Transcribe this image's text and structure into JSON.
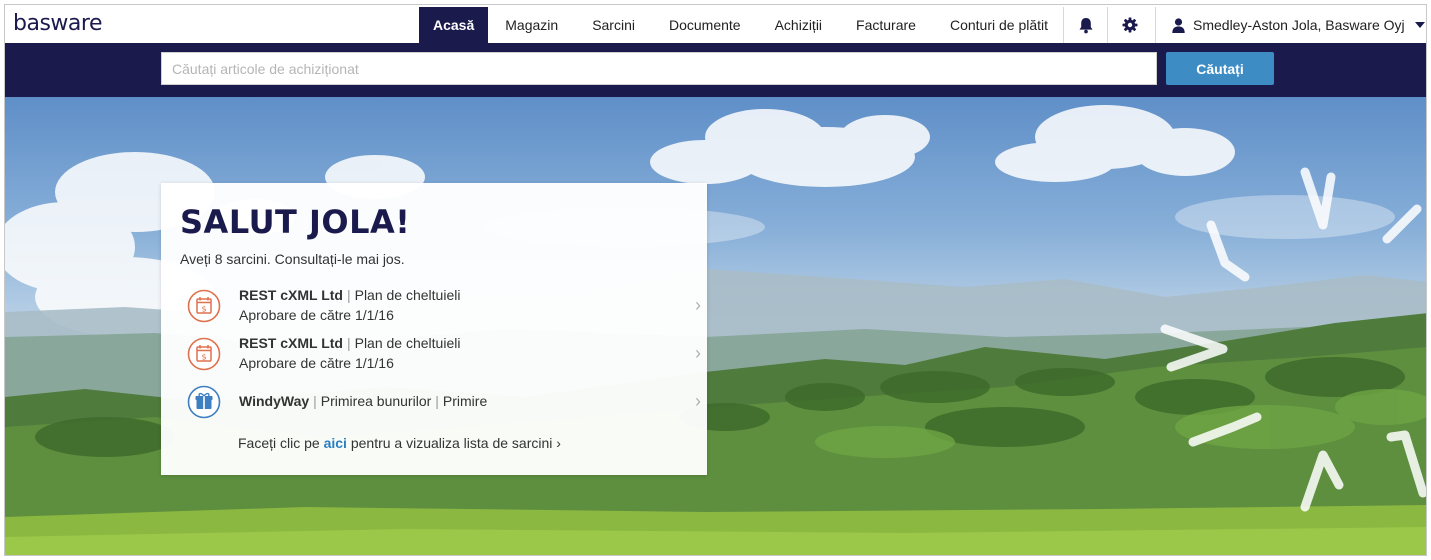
{
  "brand": {
    "logo": "basware"
  },
  "nav": {
    "items": [
      {
        "label": "Acasă",
        "active": true
      },
      {
        "label": "Magazin"
      },
      {
        "label": "Sarcini"
      },
      {
        "label": "Documente"
      },
      {
        "label": "Achiziții"
      },
      {
        "label": "Facturare"
      },
      {
        "label": "Conturi de plătit"
      }
    ],
    "icons": [
      "bell-icon",
      "gear-icon"
    ],
    "user": {
      "name": "Smedley-Aston Jola, Basware Oyj",
      "icon": "user-icon"
    }
  },
  "search": {
    "placeholder": "Căutați articole de achiziționat",
    "value": "",
    "button_label": "Căutați"
  },
  "welcome": {
    "title": "SALUT JOLA!",
    "subtitle": "Aveți 8 sarcini. Consultați-le mai jos.",
    "tasks": [
      {
        "icon": "calendar-dollar-icon",
        "company": "REST cXML Ltd",
        "type": "Plan de cheltuieli",
        "detail": "Aprobare de către 1/1/16"
      },
      {
        "icon": "calendar-dollar-icon",
        "company": "REST cXML Ltd",
        "type": "Plan de cheltuieli",
        "detail": "Aprobare de către 1/1/16"
      },
      {
        "icon": "gift-icon",
        "company": "WindyWay",
        "type": "Primirea bunurilor",
        "detail": "Primire"
      }
    ],
    "footer": {
      "prefix": "Faceți clic pe ",
      "link": "aici",
      "suffix": " pentru a vizualiza lista de sarcini ›"
    }
  },
  "colors": {
    "brand_navy": "#1b1a4d",
    "accent_blue": "#3d8cc4",
    "task_icon_orange": "#e0714f",
    "task_icon_blue": "#3d7fc0"
  }
}
